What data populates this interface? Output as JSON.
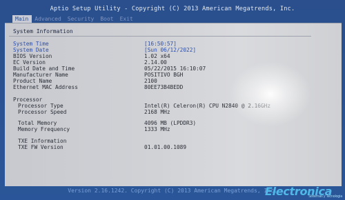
{
  "title": "Aptio Setup Utility - Copyright (C) 2013 American Megatrends, Inc.",
  "tabs": [
    "Main",
    "Advanced",
    "Security",
    "Boot",
    "Exit"
  ],
  "section_title": "System Information",
  "rows": [
    {
      "label": "System Time",
      "value": "[16:50:57]"
    },
    {
      "label": "System Date",
      "value": "[Sun 06/12/2022]"
    },
    {
      "label": "BIOS Version",
      "value": "1.02 x64"
    },
    {
      "label": "EC Version",
      "value": "2.14.00"
    },
    {
      "label": "Build Date and Time",
      "value": "05/22/2015 16:10:07"
    },
    {
      "label": "Manufacturer Name",
      "value": "POSITIVO BGH"
    },
    {
      "label": "Product Name",
      "value": "2100"
    },
    {
      "label": "Ethernet MAC Address",
      "value": "80EE73B4BEDD"
    },
    {
      "label": "Processor",
      "value": ""
    },
    {
      "label": "Processor Type",
      "value": "Intel(R) Celeron(R) CPU N2840 @ 2.16GHz"
    },
    {
      "label": "Processor Speed",
      "value": "2168 MHz"
    },
    {
      "label": "Total Memory",
      "value": "4096 MB (LPDDR3)"
    },
    {
      "label": "Memory Frequency",
      "value": "1333 MHz"
    },
    {
      "label": "TXE Information",
      "value": ""
    },
    {
      "label": "TXE FW Version",
      "value": "01.01.00.1089"
    }
  ],
  "footer": "Version 2.16.1242. Copyright (C) 2013 American Megatrends, Inc.",
  "watermark": {
    "text": "Electronica",
    "sub": "Sistemas y Tecnologia"
  },
  "colors": {
    "accent": "#2a4f8c",
    "panel": "#d0d1d5",
    "selected_text": "#2b4fb0"
  }
}
